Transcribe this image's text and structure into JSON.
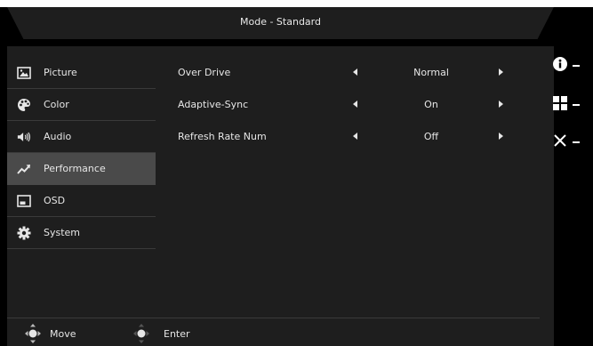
{
  "header": {
    "title": "Mode - Standard"
  },
  "sidebar": {
    "items": [
      {
        "label": "Picture",
        "icon": "picture-icon"
      },
      {
        "label": "Color",
        "icon": "palette-icon"
      },
      {
        "label": "Audio",
        "icon": "speaker-icon"
      },
      {
        "label": "Performance",
        "icon": "trend-icon",
        "active": true
      },
      {
        "label": "OSD",
        "icon": "osd-icon"
      },
      {
        "label": "System",
        "icon": "gear-icon"
      }
    ]
  },
  "settings": [
    {
      "label": "Over Drive",
      "value": "Normal"
    },
    {
      "label": "Adaptive-Sync",
      "value": "On"
    },
    {
      "label": "Refresh Rate Num",
      "value": "Off"
    }
  ],
  "footer": {
    "move_label": "Move",
    "enter_label": "Enter"
  },
  "hotkeys": [
    {
      "icon": "info-icon"
    },
    {
      "icon": "grid-icon"
    },
    {
      "icon": "close-icon"
    }
  ],
  "colors": {
    "background": "#000000",
    "panel": "#1e1e1e",
    "active": "#4a4a4a",
    "text": "#e6e6e6"
  }
}
